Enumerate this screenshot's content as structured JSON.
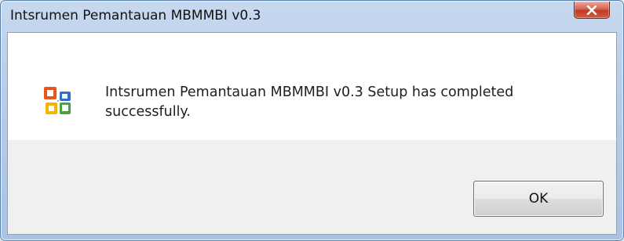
{
  "window": {
    "title": "Intsrumen Pemantauan MBMMBI v0.3",
    "close_icon": "close-icon"
  },
  "dialog": {
    "icon": "office-setup-icon",
    "message": "Intsrumen Pemantauan MBMMBI v0.3 Setup has completed successfully.",
    "ok_label": "OK"
  },
  "colors": {
    "frame": "#b9cfea",
    "close_button": "#c13a22",
    "content_background": "#ffffff",
    "footer_background": "#f0f0f0"
  }
}
